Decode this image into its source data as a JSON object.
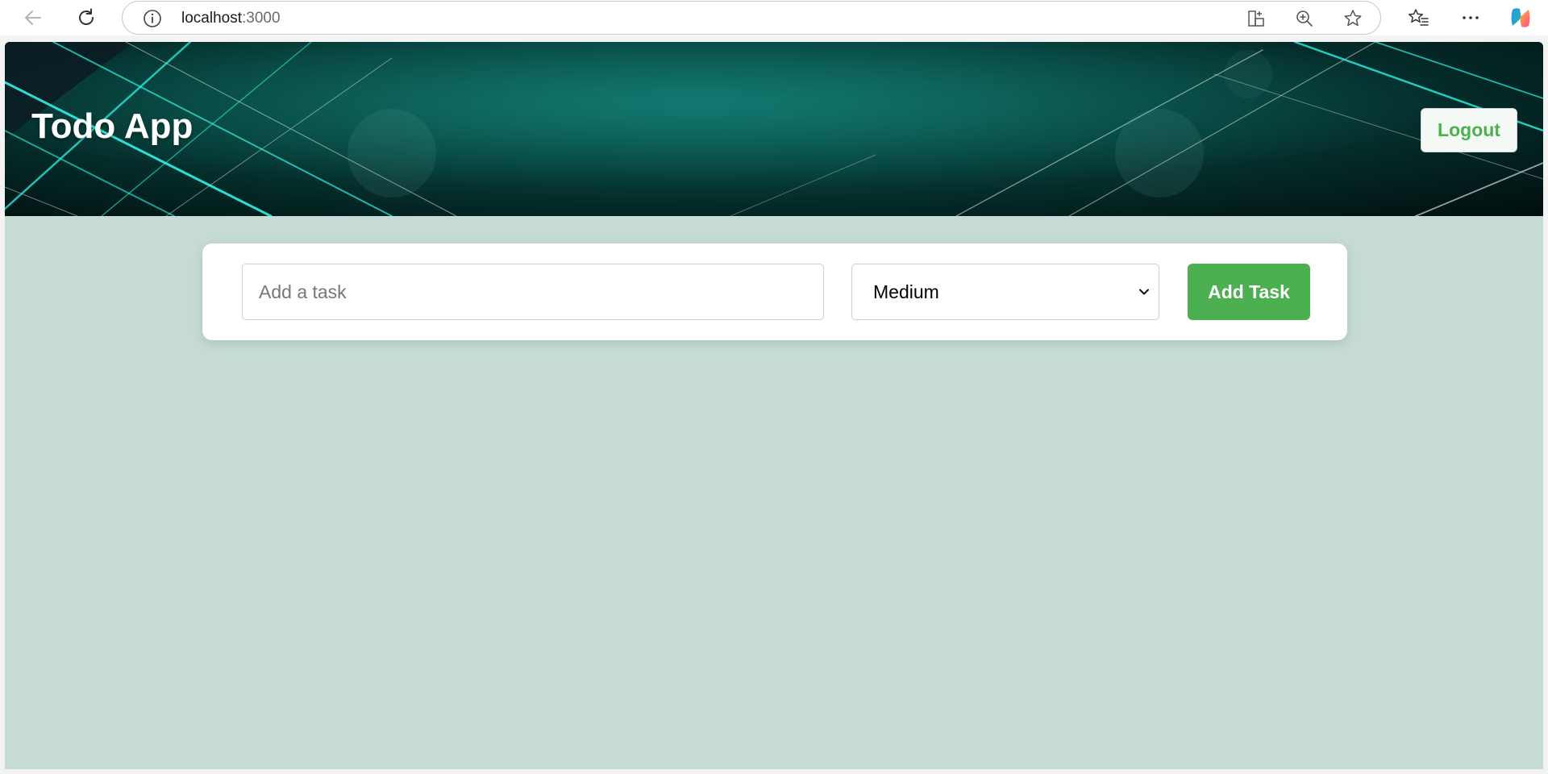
{
  "browser": {
    "url_host": "localhost",
    "url_port": ":3000",
    "icons": {
      "back": "arrow-left-icon",
      "reload": "reload-icon",
      "site_info": "info-icon",
      "apps": "add-app-icon",
      "zoom": "zoom-in-icon",
      "favorite": "star-icon",
      "favorites_list": "favorites-list-icon",
      "more": "more-icon",
      "copilot": "copilot-icon"
    }
  },
  "header": {
    "title": "Todo App",
    "logout_label": "Logout"
  },
  "task_form": {
    "input_placeholder": "Add a task",
    "input_value": "",
    "priority_selected": "Medium",
    "add_label": "Add Task"
  },
  "colors": {
    "accent": "#4caf50",
    "page_background": "#c6dbd6",
    "header_dark": "#032523",
    "header_teal": "#0f6a63"
  }
}
